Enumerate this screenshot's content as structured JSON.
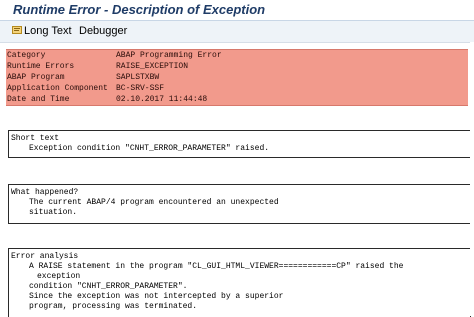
{
  "window": {
    "title": "Runtime Error - Description of Exception"
  },
  "toolbar": {
    "long_text": "Long Text",
    "debugger": "Debugger"
  },
  "header": {
    "rows": [
      {
        "label": "Category",
        "value": "ABAP Programming Error"
      },
      {
        "label": "Runtime Errors",
        "value": "RAISE_EXCEPTION"
      },
      {
        "label": "ABAP Program",
        "value": "SAPLSTXBW"
      },
      {
        "label": "Application Component",
        "value": "BC-SRV-SSF"
      },
      {
        "label": "Date and Time",
        "value": "02.10.2017 11:44:48"
      }
    ],
    "color": "#f29a8c"
  },
  "sections": {
    "short_text": {
      "title": "Short text",
      "lines": [
        "Exception condition \"CNHT_ERROR_PARAMETER\" raised."
      ]
    },
    "what_happened": {
      "title": "What happened?",
      "lines": [
        "The current ABAP/4 program encountered an unexpected",
        "situation."
      ]
    },
    "error_analysis": {
      "title": "Error analysis",
      "lines": [
        "A RAISE statement in the program \"CL_GUI_HTML_VIEWER============CP\" raised the",
        "exception",
        "condition \"CNHT_ERROR_PARAMETER\".",
        "Since the exception was not intercepted by a superior",
        "program, processing was terminated."
      ]
    }
  }
}
